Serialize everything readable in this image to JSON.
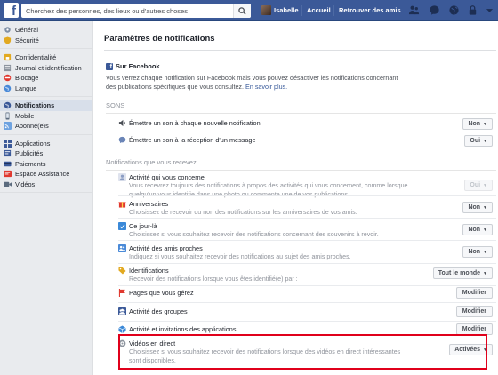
{
  "topbar": {
    "search_placeholder": "Cherchez des personnes, des lieux ou d'autres choses",
    "user_name": "Isabelle",
    "home": "Accueil",
    "find_friends": "Retrouver des amis",
    "brand_color": "#3b5998"
  },
  "sidebar": {
    "groups": [
      [
        {
          "label": "Général",
          "icon": "gear-icon"
        },
        {
          "label": "Sécurité",
          "icon": "shield-icon"
        }
      ],
      [
        {
          "label": "Confidentialité",
          "icon": "lock-icon"
        },
        {
          "label": "Journal et identification",
          "icon": "timeline-icon"
        },
        {
          "label": "Blocage",
          "icon": "block-icon"
        },
        {
          "label": "Langue",
          "icon": "globe-icon"
        }
      ],
      [
        {
          "label": "Notifications",
          "icon": "globe-notification-icon",
          "active": true
        },
        {
          "label": "Mobile",
          "icon": "mobile-icon"
        },
        {
          "label": "Abonné(e)s",
          "icon": "rss-icon"
        }
      ],
      [
        {
          "label": "Applications",
          "icon": "apps-icon"
        },
        {
          "label": "Publicités",
          "icon": "ads-icon"
        },
        {
          "label": "Paiements",
          "icon": "payment-icon"
        },
        {
          "label": "Espace Assistance",
          "icon": "help-icon"
        },
        {
          "label": "Vidéos",
          "icon": "video-icon"
        }
      ]
    ]
  },
  "main": {
    "title": "Paramètres de notifications",
    "section": "Sur Facebook",
    "intro": "Vous verrez chaque notification sur Facebook mais vous pouvez désactiver les notifications concernant des publications spécifiques que vous consultez.",
    "intro_link": "En savoir plus.",
    "sounds_head": "SONS",
    "sounds": [
      {
        "title": "Émettre un son à chaque nouvelle notification",
        "value": "Non"
      },
      {
        "title": "Émettre un son à la réception d'un message",
        "value": "Oui"
      }
    ],
    "receive_head": "Notifications que vous recevez",
    "rows": [
      {
        "title": "Activité qui vous concerne",
        "desc": "Vous recevrez toujours des notifications à propos des activités qui vous concernent, comme lorsque quelqu'un vous identifie dans une photo ou commente une de vos publications.",
        "value": "Oui",
        "kind": "disabled"
      },
      {
        "title": "Anniversaires",
        "desc": "Choisissez de recevoir ou non des notifications sur les anniversaires de vos amis.",
        "value": "Non",
        "kind": "dropdown"
      },
      {
        "title": "Ce jour-là",
        "desc": "Choisissez si vous souhaitez recevoir des notifications concernant des souvenirs à revoir.",
        "value": "Non",
        "kind": "dropdown"
      },
      {
        "title": "Activité des amis proches",
        "desc": "Indiquez si vous souhaitez recevoir des notifications au sujet des amis proches.",
        "value": "Non",
        "kind": "dropdown"
      },
      {
        "title": "Identifications",
        "desc": "Recevoir des notifications lorsque vous êtes identifié(e) par :",
        "value": "Tout le monde",
        "kind": "dropdown"
      },
      {
        "title": "Pages que vous gérez",
        "desc": "",
        "value": "Modifier",
        "kind": "button"
      },
      {
        "title": "Activité des groupes",
        "desc": "",
        "value": "Modifier",
        "kind": "button"
      },
      {
        "title": "Activité et invitations des applications",
        "desc": "",
        "value": "Modifier",
        "kind": "button"
      },
      {
        "title": "Vidéos en direct",
        "desc": "Choisissez si vous souhaitez recevoir des notifications lorsque des vidéos en direct intéressantes sont disponibles.",
        "value": "Activées",
        "kind": "dropdown"
      }
    ],
    "highlight_color": "#e0001b"
  }
}
